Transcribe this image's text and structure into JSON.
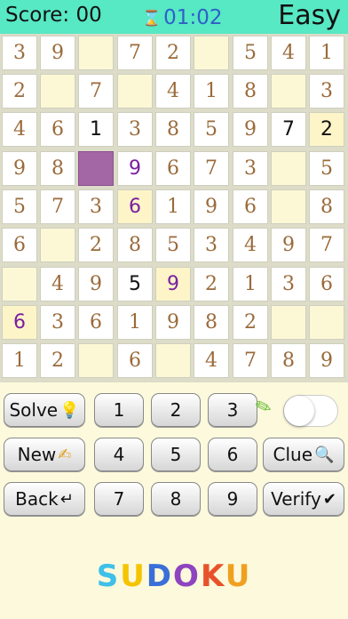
{
  "header": {
    "score_label": "Score: 00",
    "hourglass_icon": "hourglass-icon",
    "timer": "01:02",
    "difficulty": "Easy"
  },
  "board": [
    [
      "3",
      "9",
      "",
      "7",
      "2",
      "",
      "5",
      "4",
      "1"
    ],
    [
      "2",
      "",
      "7",
      "",
      "4",
      "1",
      "8",
      "",
      "3"
    ],
    [
      "4",
      "6",
      "1",
      "3",
      "8",
      "5",
      "9",
      "7",
      "2"
    ],
    [
      "9",
      "8",
      "",
      "9",
      "6",
      "7",
      "3",
      "",
      "5"
    ],
    [
      "5",
      "7",
      "3",
      "6",
      "1",
      "9",
      "6",
      "",
      "8"
    ],
    [
      "6",
      "",
      "2",
      "8",
      "5",
      "3",
      "4",
      "9",
      "7"
    ],
    [
      "",
      "4",
      "9",
      "5",
      "9",
      "2",
      "1",
      "3",
      "6"
    ],
    [
      "6",
      "3",
      "6",
      "1",
      "9",
      "8",
      "2",
      "",
      ""
    ],
    [
      "1",
      "2",
      "",
      "6",
      "",
      "4",
      "7",
      "8",
      "9"
    ]
  ],
  "cell_kinds": [
    [
      "g",
      "g",
      "e",
      "g",
      "g",
      "e",
      "g",
      "g",
      "g"
    ],
    [
      "g",
      "e",
      "g",
      "e",
      "g",
      "g",
      "g",
      "e",
      "g"
    ],
    [
      "g",
      "g",
      "u",
      "g",
      "g",
      "g",
      "g",
      "u",
      "ue"
    ],
    [
      "g",
      "g",
      "s",
      "h",
      "g",
      "g",
      "g",
      "e",
      "g"
    ],
    [
      "g",
      "g",
      "g",
      "he",
      "g",
      "g",
      "g",
      "e",
      "g"
    ],
    [
      "g",
      "e",
      "g",
      "g",
      "g",
      "g",
      "g",
      "g",
      "g"
    ],
    [
      "e",
      "g",
      "g",
      "u",
      "he",
      "g",
      "g",
      "g",
      "g"
    ],
    [
      "he",
      "g",
      "g",
      "g",
      "g",
      "g",
      "g",
      "e",
      "e"
    ],
    [
      "g",
      "g",
      "e",
      "g",
      "e",
      "g",
      "g",
      "g",
      "g"
    ]
  ],
  "controls": {
    "solve": "Solve",
    "new": "New",
    "clue": "Clue",
    "back": "Back",
    "verify": "Verify",
    "digits": [
      "1",
      "2",
      "3",
      "4",
      "5",
      "6",
      "7",
      "8",
      "9"
    ],
    "pencil_toggle_on": false
  },
  "logo": {
    "letters": [
      "S",
      "U",
      "D",
      "O",
      "K",
      "U"
    ],
    "colors": [
      "#3ec0e8",
      "#f5c400",
      "#3a6fd8",
      "#8e44c0",
      "#e8522a",
      "#f0a020"
    ]
  },
  "colors": {
    "header_bg": "#57e8c4",
    "given_digit": "#9a6a3a",
    "hint_digit": "#7b1fa2",
    "selected_cell": "#a367a6",
    "timer": "#2e60c8"
  }
}
